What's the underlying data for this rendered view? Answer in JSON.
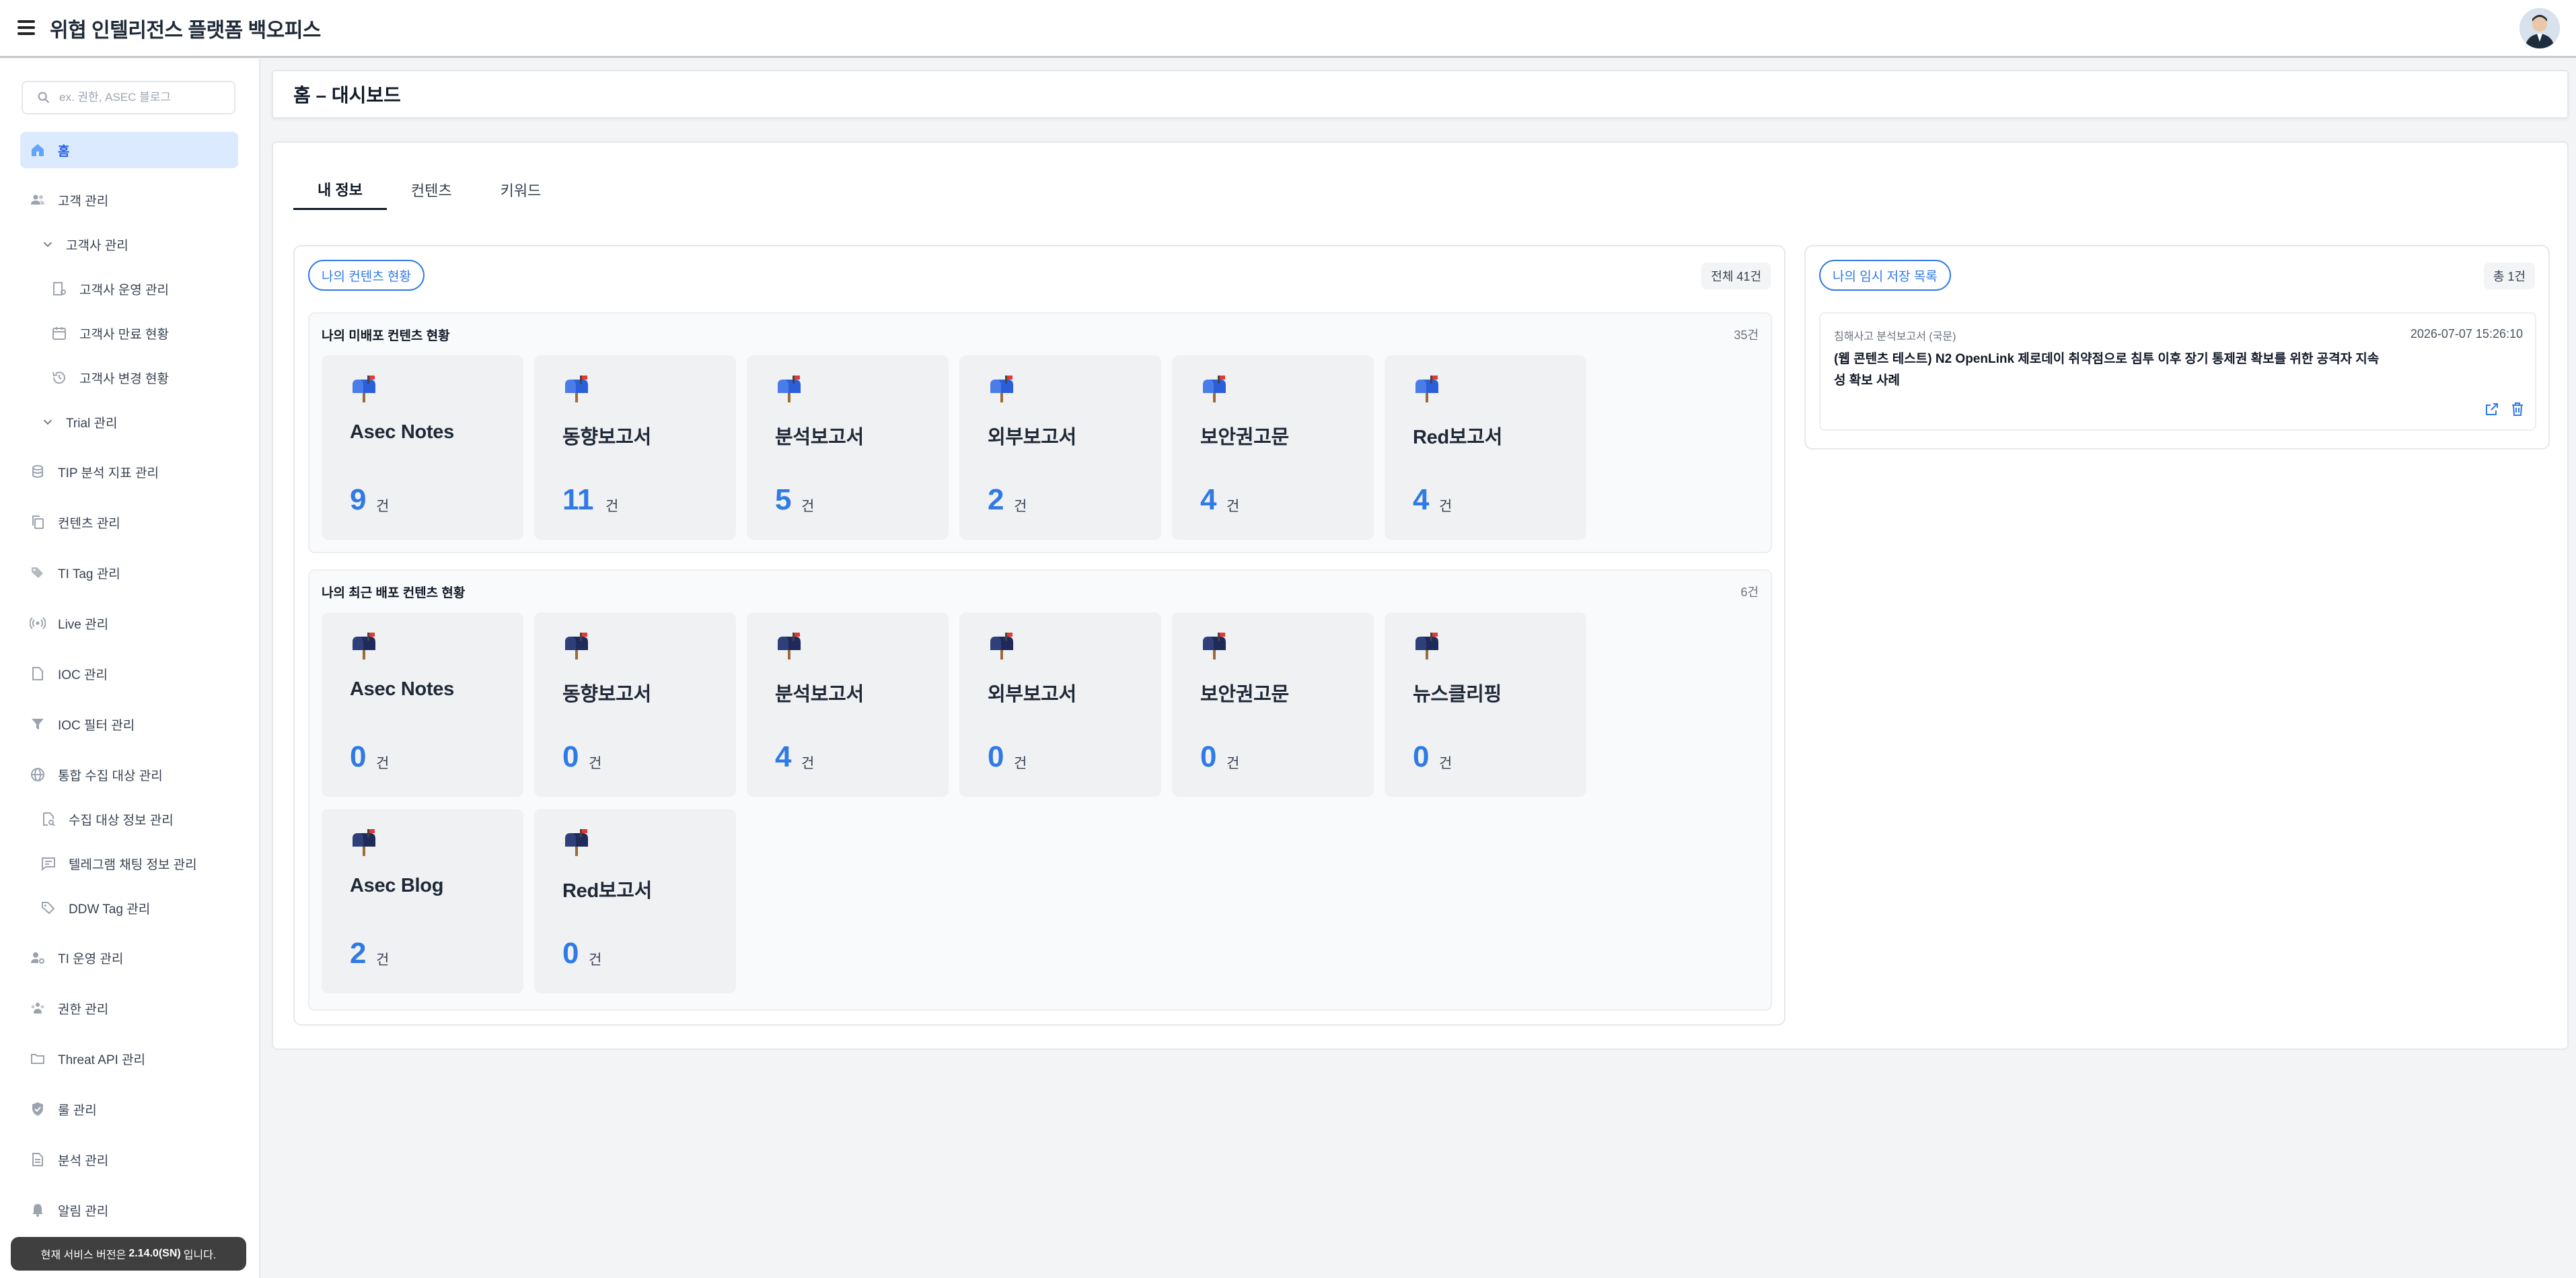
{
  "app": {
    "title": "위협 인텔리전스 플랫폼 백오피스"
  },
  "search": {
    "placeholder": "ex. 권한, ASEC 블로그"
  },
  "sidebar": {
    "items": [
      {
        "label": "홈",
        "icon": "home-icon",
        "active": true
      },
      {
        "label": "고객 관리",
        "icon": "users-icon"
      },
      {
        "label": "고객사 관리",
        "icon": "chevron-down-icon"
      },
      {
        "label": "고객사 운영 관리",
        "icon": "building-settings-icon"
      },
      {
        "label": "고객사 만료 현황",
        "icon": "calendar-icon"
      },
      {
        "label": "고객사 변경 현황",
        "icon": "history-icon"
      },
      {
        "label": "Trial 관리",
        "icon": "chevron-down-icon"
      },
      {
        "label": "TIP 분석 지표 관리",
        "icon": "database-icon"
      },
      {
        "label": "컨텐츠 관리",
        "icon": "copy-icon"
      },
      {
        "label": "TI Tag 관리",
        "icon": "tags-icon"
      },
      {
        "label": "Live 관리",
        "icon": "broadcast-icon"
      },
      {
        "label": "IOC 관리",
        "icon": "file-icon"
      },
      {
        "label": "IOC 필터 관리",
        "icon": "filter-icon"
      },
      {
        "label": "통합 수집 대상 관리",
        "icon": "globe-icon"
      },
      {
        "label": "수집 대상 정보 관리",
        "icon": "search-file-icon"
      },
      {
        "label": "텔레그램 채팅 정보 관리",
        "icon": "chat-icon"
      },
      {
        "label": "DDW Tag 관리",
        "icon": "tag-icon"
      },
      {
        "label": "TI 운영 관리",
        "icon": "user-gear-icon"
      },
      {
        "label": "권한 관리",
        "icon": "group-icon"
      },
      {
        "label": "Threat API 관리",
        "icon": "folder-icon"
      },
      {
        "label": "룰 관리",
        "icon": "shield-icon"
      },
      {
        "label": "분석 관리",
        "icon": "document-icon"
      },
      {
        "label": "알림 관리",
        "icon": "bell-icon"
      }
    ],
    "version_prefix": "현재 서비스 버전은",
    "version": "2.14.0(SN)",
    "version_suffix": "입니다."
  },
  "header": {
    "breadcrumb": "홈 – 대시보드"
  },
  "tabs": [
    "내 정보",
    "컨텐츠",
    "키워드"
  ],
  "my_contents": {
    "button": "나의 컨텐츠 현황",
    "total": "전체 41건",
    "undeployed": {
      "title": "나의 미배포 컨텐츠 현황",
      "count": "35건",
      "cards": [
        {
          "label": "Asec Notes",
          "value": "9",
          "unit": "건"
        },
        {
          "label": "동향보고서",
          "value": "11",
          "unit": "건"
        },
        {
          "label": "분석보고서",
          "value": "5",
          "unit": "건"
        },
        {
          "label": "외부보고서",
          "value": "2",
          "unit": "건"
        },
        {
          "label": "보안권고문",
          "value": "4",
          "unit": "건"
        },
        {
          "label": "Red보고서",
          "value": "4",
          "unit": "건"
        }
      ]
    },
    "recent": {
      "title": "나의 최근 배포 컨텐츠 현황",
      "count": "6건",
      "cards": [
        {
          "label": "Asec Notes",
          "value": "0",
          "unit": "건"
        },
        {
          "label": "동향보고서",
          "value": "0",
          "unit": "건"
        },
        {
          "label": "분석보고서",
          "value": "4",
          "unit": "건"
        },
        {
          "label": "외부보고서",
          "value": "0",
          "unit": "건"
        },
        {
          "label": "보안권고문",
          "value": "0",
          "unit": "건"
        },
        {
          "label": "뉴스클리핑",
          "value": "0",
          "unit": "건"
        },
        {
          "label": "Asec Blog",
          "value": "2",
          "unit": "건"
        },
        {
          "label": "Red보고서",
          "value": "0",
          "unit": "건"
        }
      ]
    }
  },
  "drafts": {
    "button": "나의 임시 저장 목록",
    "total": "총 1건",
    "items": [
      {
        "category": "침해사고 분석보고서 (국문)",
        "date": "2026-07-07 15:26:10",
        "title": "(웹 콘텐츠 테스트) N2 OpenLink 제로데이 취약점으로 침투 이후 장기 통제권 확보를 위한 공격자 지속성 확보 사례"
      }
    ]
  },
  "colors": {
    "accent": "#2f7ae5",
    "active_bg": "#dbeafe",
    "active_text": "#2563eb"
  }
}
